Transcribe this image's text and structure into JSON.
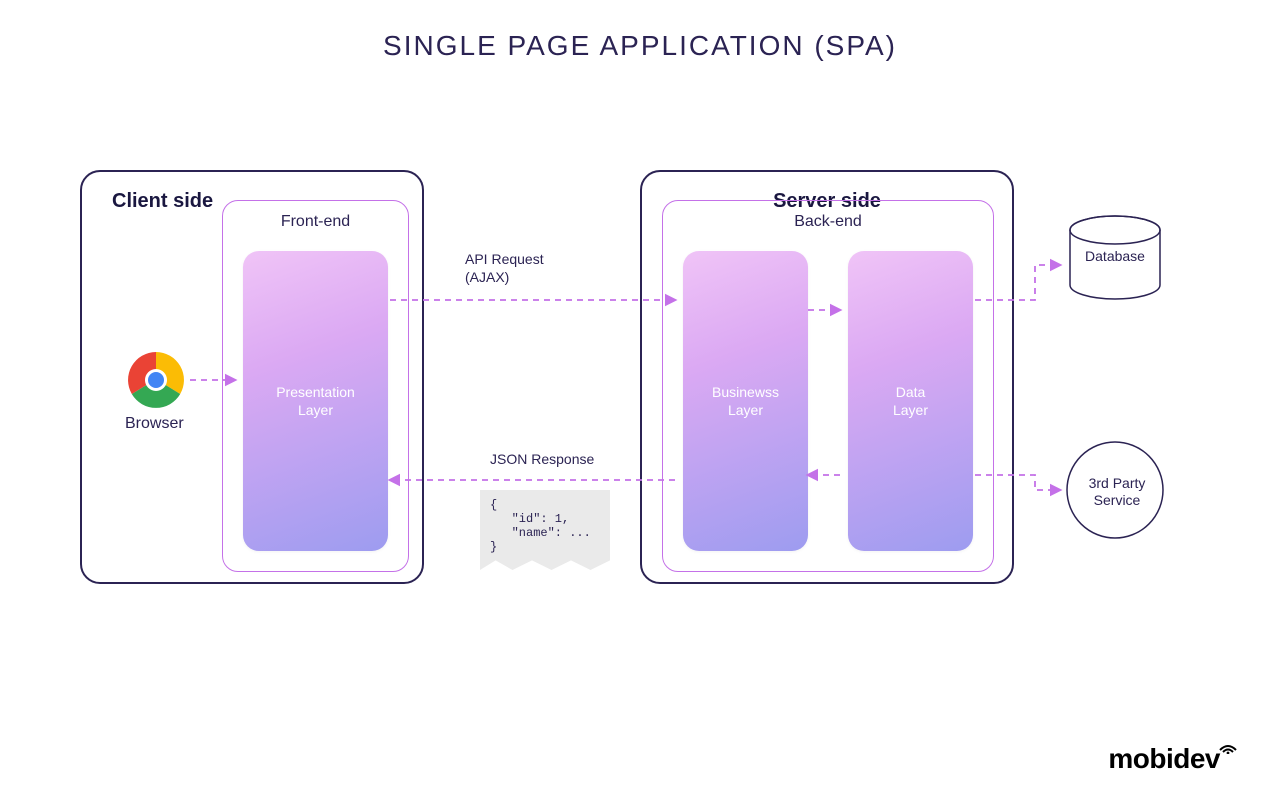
{
  "title": "SINGLE PAGE APPLICATION (SPA)",
  "client": {
    "panel_title": "Client side",
    "inner_title": "Front-end",
    "layer": "Presentation\nLayer",
    "browser_label": "Browser"
  },
  "server": {
    "panel_title": "Server side",
    "inner_title": "Back-end",
    "business_layer": "Businewss\nLayer",
    "data_layer": "Data\nLayer"
  },
  "flows": {
    "request_label": "API Request\n(AJAX)",
    "response_label": "JSON Response",
    "json_snippet": "{\n   \"id\": 1,\n   \"name\": ...\n}"
  },
  "externals": {
    "database": "Database",
    "third_party": "3rd Party\nService"
  },
  "brand": "mobidev"
}
